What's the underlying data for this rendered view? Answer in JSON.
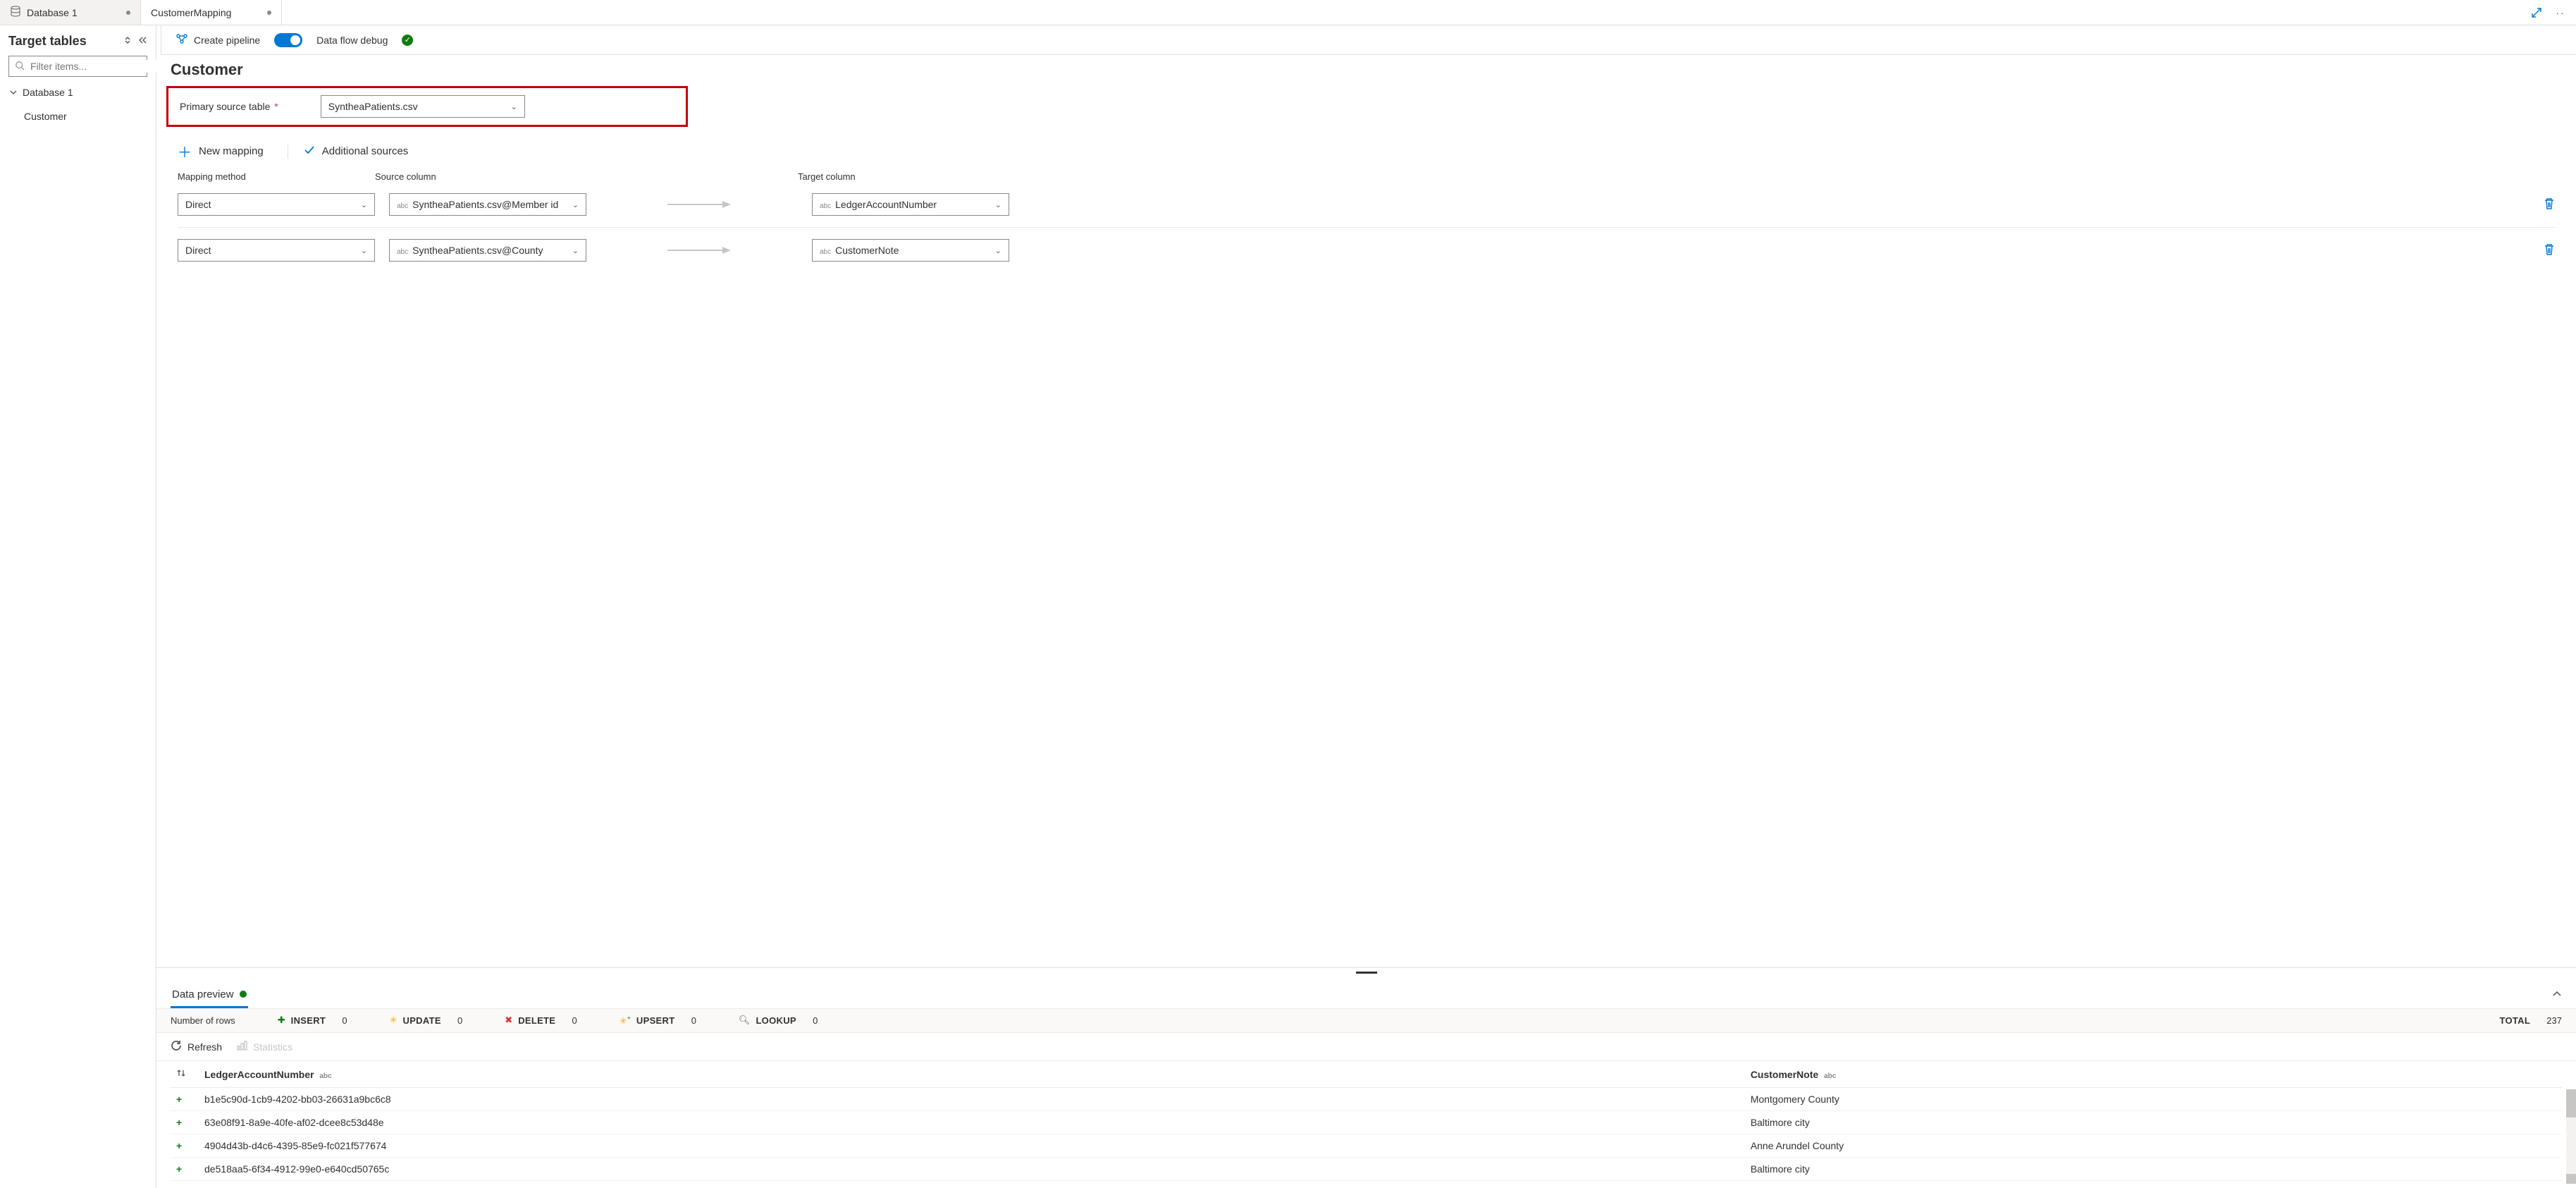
{
  "tabs": [
    {
      "label": "Database 1",
      "icon": "database",
      "dirty": true,
      "active": false
    },
    {
      "label": "CustomerMapping",
      "icon": "",
      "dirty": true,
      "active": true
    }
  ],
  "sidebar": {
    "title": "Target tables",
    "filter_placeholder": "Filter items...",
    "tree": {
      "root": "Database 1",
      "items": [
        "Customer"
      ]
    }
  },
  "toolbar": {
    "create_pipeline": "Create pipeline",
    "debug_label": "Data flow debug"
  },
  "page": {
    "title": "Customer",
    "primary_source_label": "Primary source table",
    "primary_source_value": "SyntheaPatients.csv"
  },
  "map_toolbar": {
    "new_mapping": "New mapping",
    "additional_sources": "Additional sources"
  },
  "map_headers": {
    "method": "Mapping method",
    "source": "Source column",
    "target": "Target column"
  },
  "mappings": [
    {
      "method": "Direct",
      "source": "SyntheaPatients.csv@Member id",
      "target": "LedgerAccountNumber"
    },
    {
      "method": "Direct",
      "source": "SyntheaPatients.csv@County",
      "target": "CustomerNote"
    }
  ],
  "preview": {
    "tab_label": "Data preview",
    "rows_label": "Number of rows",
    "stats": {
      "insert": "0",
      "update": "0",
      "delete": "0",
      "upsert": "0",
      "lookup": "0",
      "total": "237"
    },
    "labels": {
      "insert": "Insert",
      "update": "Update",
      "delete": "Delete",
      "upsert": "Upsert",
      "lookup": "Lookup",
      "total": "Total"
    },
    "tools": {
      "refresh": "Refresh",
      "statistics": "Statistics"
    },
    "columns": [
      "LedgerAccountNumber",
      "CustomerNote"
    ],
    "col_type": "abc",
    "rows": [
      {
        "a": "b1e5c90d-1cb9-4202-bb03-26631a9bc6c8",
        "b": "Montgomery County"
      },
      {
        "a": "63e08f91-8a9e-40fe-af02-dcee8c53d48e",
        "b": "Baltimore city"
      },
      {
        "a": "4904d43b-d4c6-4395-85e9-fc021f577674",
        "b": "Anne Arundel County"
      },
      {
        "a": "de518aa5-6f34-4912-99e0-e640cd50765c",
        "b": "Baltimore city"
      }
    ]
  }
}
